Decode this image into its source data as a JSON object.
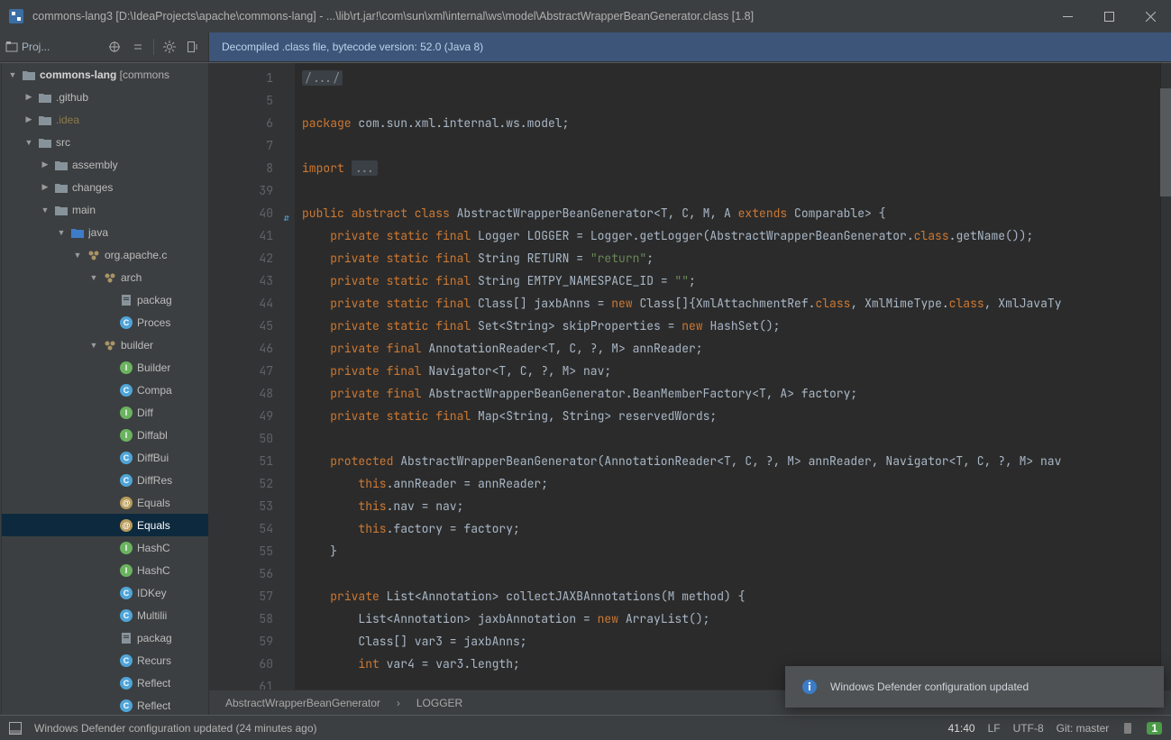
{
  "title": "commons-lang3 [D:\\IdeaProjects\\apache\\commons-lang] - ...\\lib\\rt.jar!\\com\\sun\\xml\\internal\\ws\\model\\AbstractWrapperBeanGenerator.class [1.8]",
  "toolbar": {
    "project_label": "Proj...",
    "banner": "Decompiled .class file, bytecode version: 52.0 (Java 8)"
  },
  "tree": [
    {
      "d": 0,
      "arrow": "▼",
      "icon": "folder",
      "text": "commons-lang",
      "suffix": " [commons"
    },
    {
      "d": 1,
      "arrow": "▶",
      "icon": "folder",
      "text": ".github",
      "bold": false
    },
    {
      "d": 1,
      "arrow": "▶",
      "icon": "folder",
      "text": ".idea",
      "dim": true
    },
    {
      "d": 1,
      "arrow": "▼",
      "icon": "folder",
      "text": "src"
    },
    {
      "d": 2,
      "arrow": "▶",
      "icon": "folder",
      "text": "assembly"
    },
    {
      "d": 2,
      "arrow": "▶",
      "icon": "folder",
      "text": "changes"
    },
    {
      "d": 2,
      "arrow": "▼",
      "icon": "folder",
      "text": "main"
    },
    {
      "d": 3,
      "arrow": "▼",
      "icon": "folder-src",
      "text": "java"
    },
    {
      "d": 4,
      "arrow": "▼",
      "icon": "pkg",
      "text": "org.apache.c"
    },
    {
      "d": 5,
      "arrow": "▼",
      "icon": "pkg",
      "text": "arch"
    },
    {
      "d": 6,
      "arrow": "",
      "icon": "file",
      "text": "packag"
    },
    {
      "d": 6,
      "arrow": "",
      "icon": "c",
      "text": "Proces"
    },
    {
      "d": 5,
      "arrow": "▼",
      "icon": "pkg",
      "text": "builder"
    },
    {
      "d": 6,
      "arrow": "",
      "icon": "i",
      "text": "Builder"
    },
    {
      "d": 6,
      "arrow": "",
      "icon": "c",
      "text": "Compa"
    },
    {
      "d": 6,
      "arrow": "",
      "icon": "i",
      "text": "Diff",
      "note": true
    },
    {
      "d": 6,
      "arrow": "",
      "icon": "i",
      "text": "Diffabl"
    },
    {
      "d": 6,
      "arrow": "",
      "icon": "c",
      "text": "DiffBui"
    },
    {
      "d": 6,
      "arrow": "",
      "icon": "c",
      "text": "DiffRes"
    },
    {
      "d": 6,
      "arrow": "",
      "icon": "a",
      "text": "Equals"
    },
    {
      "d": 6,
      "arrow": "",
      "icon": "a",
      "text": "Equals",
      "sel": true
    },
    {
      "d": 6,
      "arrow": "",
      "icon": "i",
      "text": "HashC"
    },
    {
      "d": 6,
      "arrow": "",
      "icon": "i",
      "text": "HashC"
    },
    {
      "d": 6,
      "arrow": "",
      "icon": "c",
      "text": "IDKey"
    },
    {
      "d": 6,
      "arrow": "",
      "icon": "c",
      "text": "Multilii"
    },
    {
      "d": 6,
      "arrow": "",
      "icon": "file",
      "text": "packag"
    },
    {
      "d": 6,
      "arrow": "",
      "icon": "c",
      "text": "Recurs"
    },
    {
      "d": 6,
      "arrow": "",
      "icon": "c",
      "text": "Reflect"
    },
    {
      "d": 6,
      "arrow": "",
      "icon": "c",
      "text": "Reflect"
    }
  ],
  "gutter_lines": [
    "1",
    "5",
    "6",
    "7",
    "8",
    "39",
    "40",
    "41",
    "42",
    "43",
    "44",
    "45",
    "46",
    "47",
    "48",
    "49",
    "50",
    "51",
    "52",
    "53",
    "54",
    "55",
    "56",
    "57",
    "58",
    "59",
    "60",
    "61"
  ],
  "code": [
    {
      "t": "fold",
      "c": "/.../"
    },
    {
      "t": "blank"
    },
    {
      "t": "pkg",
      "c": "package com.sun.xml.internal.ws.model;"
    },
    {
      "t": "blank"
    },
    {
      "t": "imp"
    },
    {
      "t": "blank"
    },
    {
      "t": "l40"
    },
    {
      "t": "l41"
    },
    {
      "t": "l42"
    },
    {
      "t": "l43"
    },
    {
      "t": "l44"
    },
    {
      "t": "l45"
    },
    {
      "t": "l46"
    },
    {
      "t": "l47"
    },
    {
      "t": "l48"
    },
    {
      "t": "l49"
    },
    {
      "t": "blank"
    },
    {
      "t": "l51"
    },
    {
      "t": "l52"
    },
    {
      "t": "l53"
    },
    {
      "t": "l54"
    },
    {
      "t": "l55"
    },
    {
      "t": "blank"
    },
    {
      "t": "l57"
    },
    {
      "t": "l58"
    },
    {
      "t": "l59"
    },
    {
      "t": "l60"
    },
    {
      "t": "blank"
    }
  ],
  "breadcrumb": {
    "a": "AbstractWrapperBeanGenerator",
    "b": "LOGGER"
  },
  "notification": "Windows Defender configuration updated",
  "status": {
    "msg": "Windows Defender configuration updated (24 minutes ago)",
    "pos": "41:40",
    "sep": "LF",
    "enc": "UTF-8",
    "vcs": "Git: master"
  }
}
